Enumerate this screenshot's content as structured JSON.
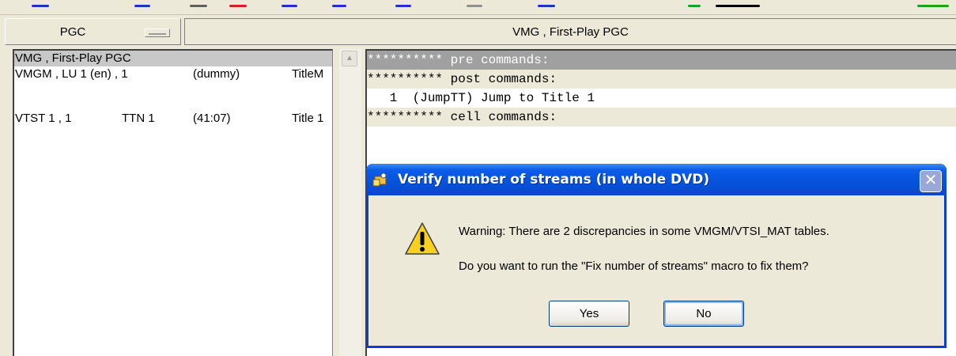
{
  "toolbar": {
    "pgc_label": "PGC",
    "title_label": "VMG , First-Play PGC"
  },
  "pgc_list": [
    {
      "col1": "VMG , First-Play PGC",
      "col2": "",
      "col3": "",
      "col4": "",
      "selected": true
    },
    {
      "col1": "VMGM , LU 1 (en) , 1",
      "col2": "",
      "col3": "(dummy)",
      "col4": "TitleM",
      "selected": false
    },
    {
      "col1": "VTST 1 , 1",
      "col2": "TTN 1",
      "col3": "(41:07)",
      "col4": "Title 1",
      "selected": false
    }
  ],
  "commands": [
    {
      "text": "********** pre commands:",
      "style": "hl"
    },
    {
      "text": "********** post commands:",
      "style": "sec"
    },
    {
      "text": "   1  (JumpTT) Jump to Title 1",
      "style": "plain"
    },
    {
      "text": "********** cell commands:",
      "style": "sec"
    }
  ],
  "dialog": {
    "title": "Verify number of streams (in whole DVD)",
    "close_glyph": "✕",
    "icon": "warning-icon",
    "message_1": "Warning: There are 2 discrepancies in some VMGM/VTSI_MAT tables.",
    "message_2": "Do you want to run the \"Fix number of streams\" macro to fix them?",
    "yes_label": "Yes",
    "no_label": "No"
  },
  "colors": {
    "titlebar": "#0650d8",
    "dialog_face": "#ece9d8",
    "selection": "#c8c8c8"
  }
}
